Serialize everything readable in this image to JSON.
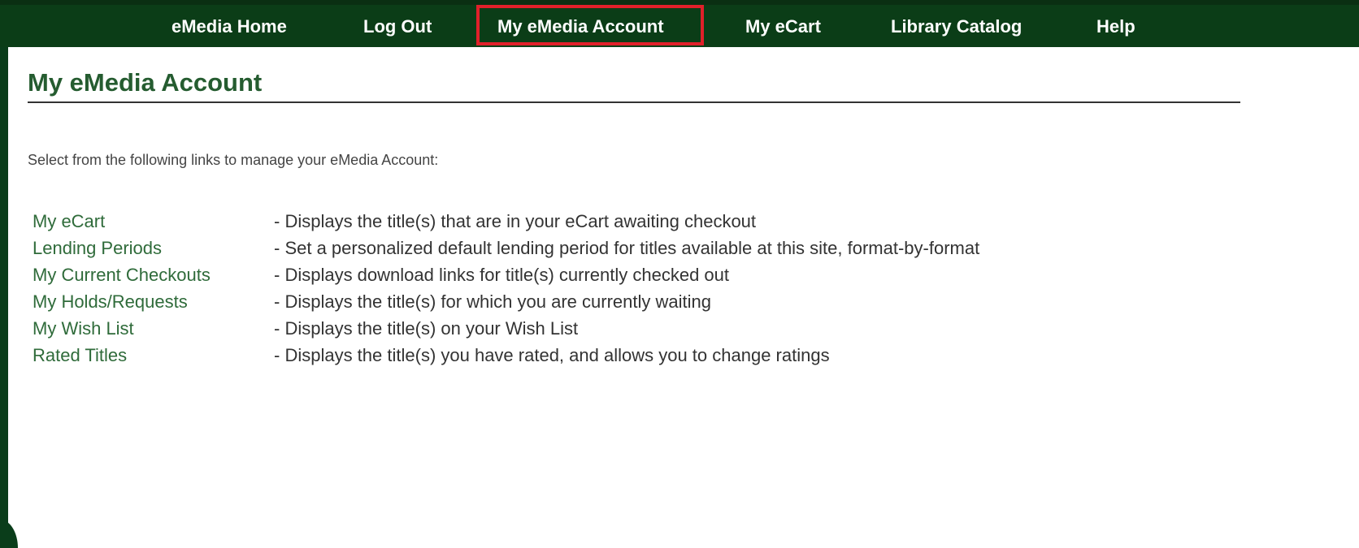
{
  "nav": {
    "items": [
      {
        "label": "eMedia Home"
      },
      {
        "label": "Log Out"
      },
      {
        "label": "My eMedia Account"
      },
      {
        "label": "My eCart"
      },
      {
        "label": "Library Catalog"
      },
      {
        "label": "Help"
      }
    ],
    "highlight_color": "#e0202a",
    "background_color": "#0b3d17"
  },
  "main": {
    "title": "My eMedia Account",
    "intro": "Select from the following links to manage your eMedia Account:",
    "links": [
      {
        "label": "My eCart",
        "description": "- Displays the title(s) that are in your eCart awaiting checkout"
      },
      {
        "label": "Lending Periods",
        "description": "- Set a personalized default lending period for titles available at this site, format-by-format"
      },
      {
        "label": "My Current Checkouts",
        "description": "- Displays download links for title(s) currently checked out"
      },
      {
        "label": "My Holds/Requests",
        "description": "- Displays the title(s) for which you are currently waiting"
      },
      {
        "label": "My Wish List",
        "description": "- Displays the title(s) on your Wish List"
      },
      {
        "label": "Rated Titles",
        "description": "- Displays the title(s) you have rated, and allows you to change ratings"
      }
    ],
    "link_color": "#2f6b3a",
    "title_color": "#255c30"
  }
}
